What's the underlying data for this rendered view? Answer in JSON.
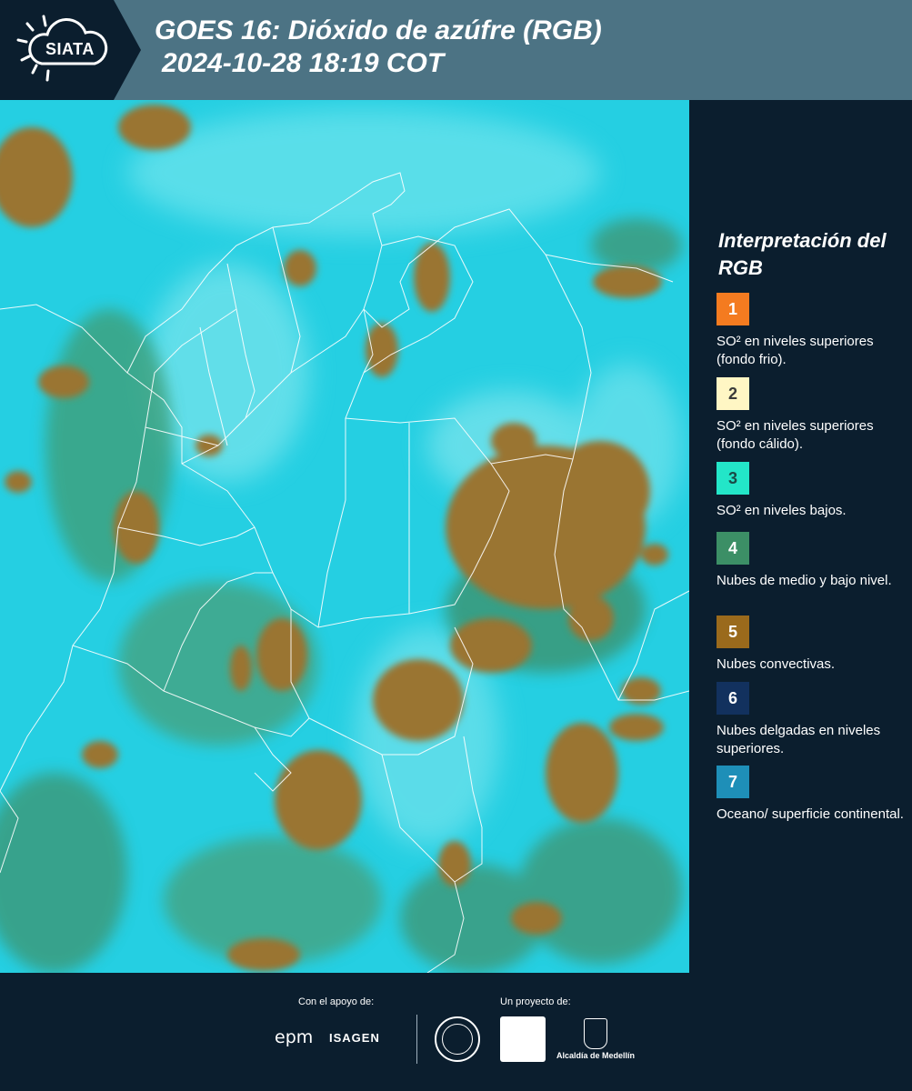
{
  "header": {
    "logo_text": "SIATA",
    "title_line1": "GOES 16: Dióxido de azúfre (RGB)",
    "title_line2": "2024-10-28 18:19 COT"
  },
  "legend": {
    "title": "Interpretación del RGB",
    "items": [
      {
        "number": "1",
        "color": "#f47b20",
        "text_color": "#ffffff",
        "label": "SO² en niveles superiores (fondo frio)."
      },
      {
        "number": "2",
        "color": "#fff6c4",
        "text_color": "#3a3a3a",
        "label": "SO² en niveles superiores (fondo cálido)."
      },
      {
        "number": "3",
        "color": "#23e6c8",
        "text_color": "#1a4a46",
        "label": "SO² en niveles bajos."
      },
      {
        "number": "4",
        "color": "#3c8f66",
        "text_color": "#ffffff",
        "label": "Nubes de medio y bajo nivel."
      },
      {
        "number": "5",
        "color": "#9a6a1c",
        "text_color": "#ffffff",
        "label": "Nubes convectivas."
      },
      {
        "number": "6",
        "color": "#12315e",
        "text_color": "#ffffff",
        "label": "Nubes delgadas en niveles superiores."
      },
      {
        "number": "7",
        "color": "#1e8fb8",
        "text_color": "#ffffff",
        "label": "Oceano/ superficie continental."
      }
    ]
  },
  "footer": {
    "support_label": "Con el apoyo de:",
    "project_label": "Un proyecto de:",
    "epm": "epm",
    "isagen": "ISAGEN",
    "alcaldia": "Alcaldía de Medellín"
  },
  "colors": {
    "header_bg": "#4c7384",
    "panel_bg": "#0b1e2e",
    "map_cyan": "#24d0e2",
    "cloud_brown": "#9a7432",
    "cloud_green": "#3e9a72"
  }
}
